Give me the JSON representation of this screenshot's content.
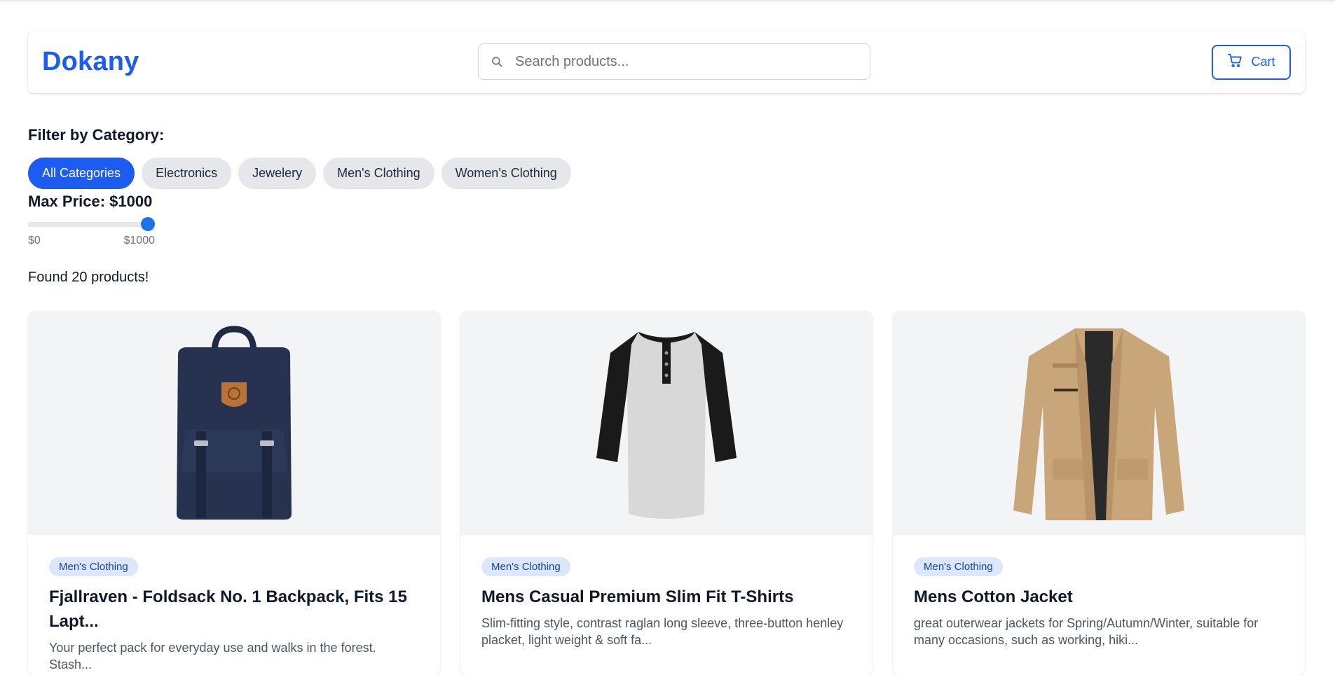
{
  "header": {
    "logo": "Dokany",
    "search_placeholder": "Search products...",
    "cart_label": "Cart"
  },
  "filters": {
    "category_title": "Filter by Category:",
    "categories": [
      {
        "label": "All Categories",
        "active": true
      },
      {
        "label": "Electronics",
        "active": false
      },
      {
        "label": "Jewelery",
        "active": false
      },
      {
        "label": "Men's Clothing",
        "active": false
      },
      {
        "label": "Women's Clothing",
        "active": false
      }
    ],
    "price_title": "Max Price: $1000",
    "price_min_label": "$0",
    "price_max_label": "$1000",
    "price_fraction": 1.0
  },
  "results": {
    "found_text": "Found 20 products!"
  },
  "products": [
    {
      "category": "Men's Clothing",
      "title": "Fjallraven - Foldsack No. 1 Backpack, Fits 15 Lapt...",
      "desc": "Your perfect pack for everyday use and walks in the forest. Stash..."
    },
    {
      "category": "Men's Clothing",
      "title": "Mens Casual Premium Slim Fit T-Shirts",
      "desc": "Slim-fitting style, contrast raglan long sleeve, three-button henley placket, light weight & soft fa..."
    },
    {
      "category": "Men's Clothing",
      "title": "Mens Cotton Jacket",
      "desc": "great outerwear jackets for Spring/Autumn/Winter, suitable for many occasions, such as working, hiki..."
    }
  ],
  "colors": {
    "accent": "#1d5cf0",
    "chip_bg": "#e5e7eb",
    "badge_bg": "#dbe7fb"
  }
}
